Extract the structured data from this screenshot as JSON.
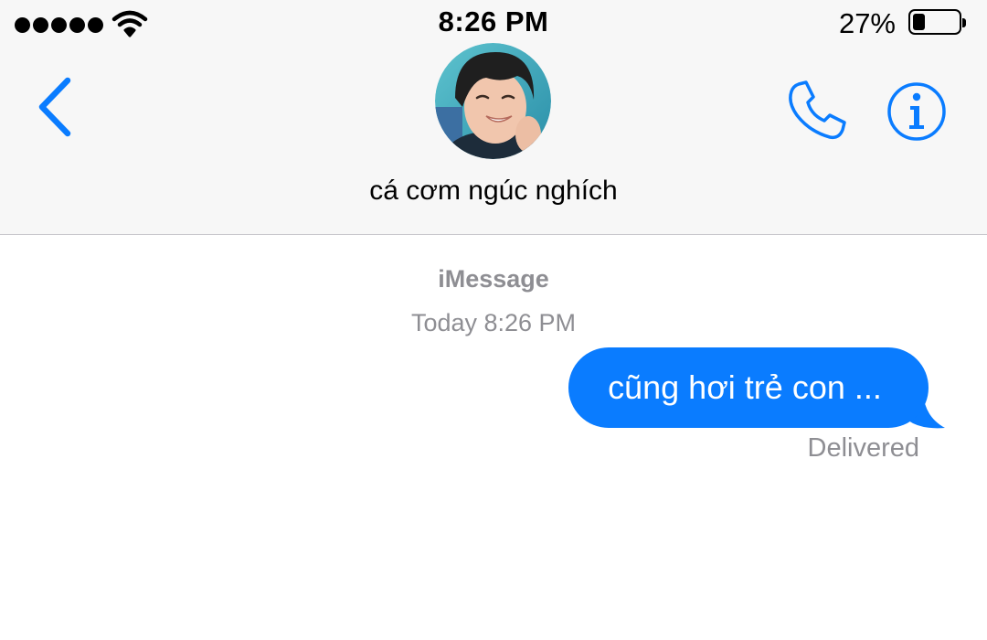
{
  "status_bar": {
    "signal_icon": "signal-dots-icon",
    "wifi_icon": "wifi-icon",
    "time": "8:26 PM",
    "battery_percent": "27%",
    "battery_level": 0.27,
    "battery_icon": "battery-icon"
  },
  "header": {
    "back_icon": "chevron-left-icon",
    "contact_name": "cá cơm ngúc nghích",
    "call_icon": "phone-icon",
    "info_icon": "info-icon",
    "accent_color": "#0a7cff"
  },
  "conversation": {
    "service_label": "iMessage",
    "timestamp": "Today 8:26 PM",
    "messages": [
      {
        "direction": "outgoing",
        "text": "cũng hơi trẻ con ...",
        "status": "Delivered",
        "bubble_color": "#0a7cff"
      }
    ]
  }
}
